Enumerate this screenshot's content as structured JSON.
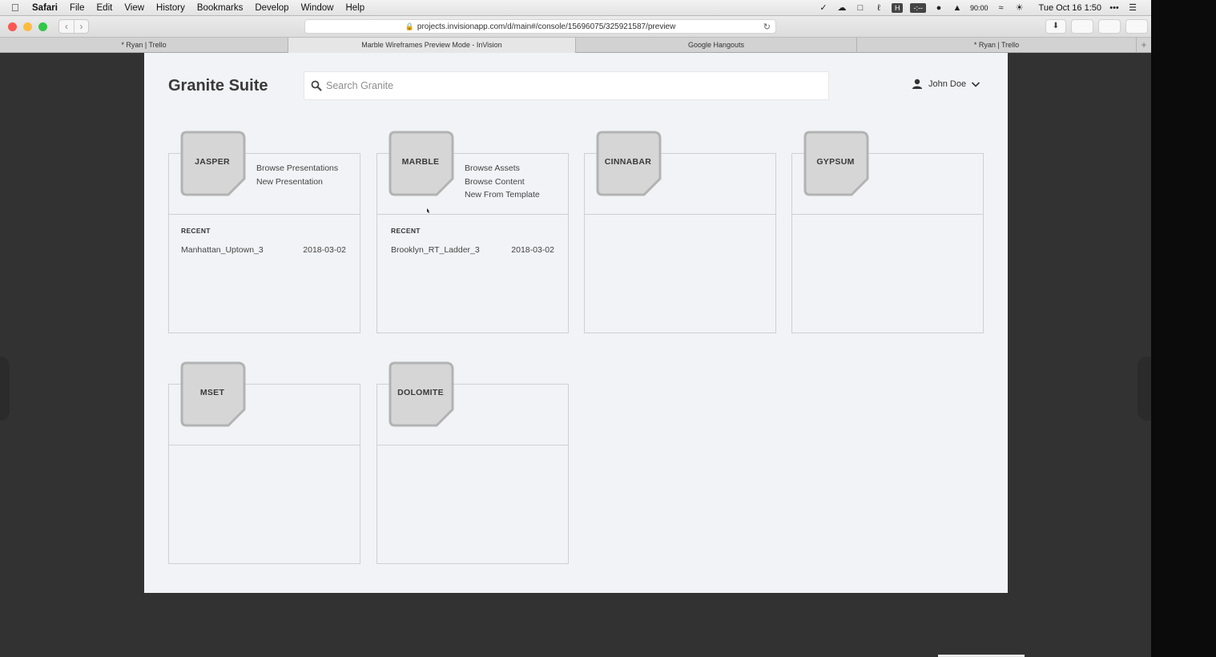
{
  "menubar": {
    "app": "Safari",
    "items": [
      "File",
      "Edit",
      "View",
      "History",
      "Bookmarks",
      "Develop",
      "Window",
      "Help"
    ],
    "status": {
      "battery_text": "90:00",
      "datetime": "Tue Oct 16  1:50",
      "h_badge": "H",
      "dash_badge": "-:--"
    }
  },
  "toolbar": {
    "url": "projects.invisionapp.com/d/main#/console/15696075/325921587/preview"
  },
  "tabs": [
    {
      "label": "* Ryan | Trello"
    },
    {
      "label": "Marble Wireframes Preview Mode - InVision"
    },
    {
      "label": "Google Hangouts"
    },
    {
      "label": "* Ryan | Trello"
    }
  ],
  "app": {
    "title": "Granite Suite",
    "search_placeholder": "Search Granite",
    "user_name": "John Doe"
  },
  "cards": {
    "jasper": {
      "name": "JASPER",
      "links": [
        "Browse Presentations",
        "New Presentation"
      ],
      "recent_label": "RECENT",
      "recent": [
        {
          "name": "Manhattan_Uptown_3",
          "date": "2018-03-02"
        }
      ]
    },
    "marble": {
      "name": "MARBLE",
      "links": [
        "Browse Assets",
        "Browse Content",
        "New From Template"
      ],
      "recent_label": "RECENT",
      "recent": [
        {
          "name": "Brooklyn_RT_Ladder_3",
          "date": "2018-03-02"
        }
      ]
    },
    "cinnabar": {
      "name": "CINNABAR"
    },
    "gypsum": {
      "name": "GYPSUM"
    },
    "mset": {
      "name": "MSET"
    },
    "dolomite": {
      "name": "DOLOMITE"
    }
  }
}
